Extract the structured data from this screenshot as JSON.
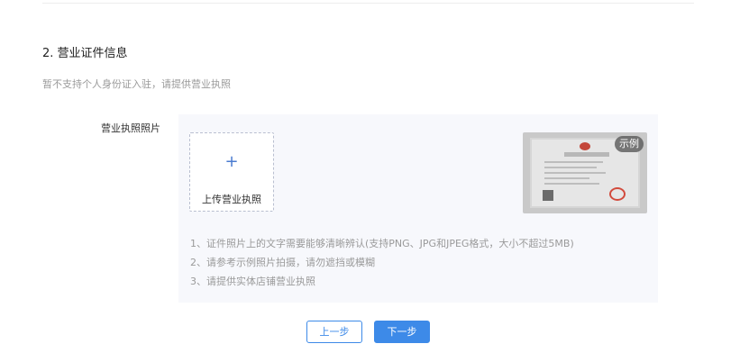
{
  "section": {
    "title": "2. 营业证件信息",
    "hint": "暂不支持个人身份证入驻，请提供营业执照"
  },
  "license_photo": {
    "label": "营业执照照片",
    "upload_icon": "plus-icon",
    "upload_label": "上传营业执照",
    "sample_badge": "示例",
    "requirements": [
      "1、证件照片上的文字需要能够清晰辨认(支持PNG、JPG和JPEG格式，大小不超过5MB)",
      "2、请参考示例照片拍摄，请勿遮挡或模糊",
      "3、请提供实体店铺营业执照"
    ]
  },
  "actions": {
    "prev_label": "上一步",
    "next_label": "下一步"
  },
  "colors": {
    "accent": "#3d8ae8",
    "panel_bg": "#f7f8fc",
    "hint_text": "#9a9a9a"
  }
}
